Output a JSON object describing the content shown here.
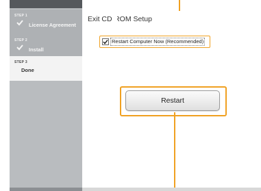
{
  "sidebar": {
    "steps": [
      {
        "label": "STEP 1",
        "title": "License Agreement",
        "state": "done"
      },
      {
        "label": "STEP 2",
        "title": "Install",
        "state": "done"
      },
      {
        "label": "STEP 3",
        "title": "Done",
        "state": "active"
      }
    ]
  },
  "main": {
    "title": "Exit CD-ROM Setup",
    "restart_checkbox": {
      "label": "Restart Computer Now (Recommended)",
      "checked": true
    },
    "restart_button": "Restart"
  },
  "colors": {
    "callout": "#f0a020",
    "sidebar": "#b9bcbf",
    "active_step": "#f3f3f3"
  }
}
